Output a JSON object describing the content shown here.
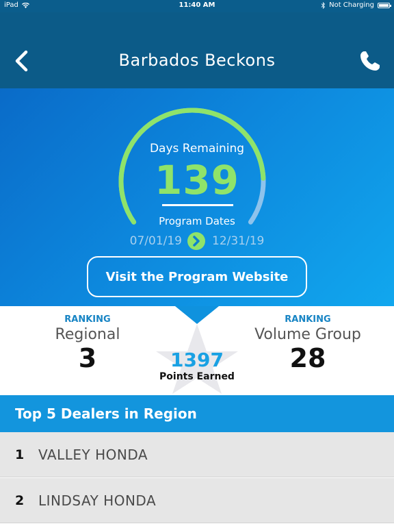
{
  "status_bar": {
    "device": "iPad",
    "time": "11:40 AM",
    "charging": "Not Charging"
  },
  "nav": {
    "title": "Barbados Beckons",
    "back_icon": "chevron-left-icon",
    "call_icon": "phone-icon"
  },
  "program": {
    "days_remaining_label": "Days Remaining",
    "days_remaining": "139",
    "days_remaining_progress": 0.85,
    "dates_label": "Program Dates",
    "start_date": "07/01/19",
    "end_date": "12/31/19",
    "visit_label": "Visit the Program Website"
  },
  "ranking": {
    "regional": {
      "caption": "RANKING",
      "name": "Regional",
      "value": "3"
    },
    "volume_group": {
      "caption": "RANKING",
      "name": "Volume Group",
      "value": "28"
    },
    "points_value": "1397",
    "points_label": "Points Earned"
  },
  "dealers": {
    "title": "Top 5 Dealers in Region",
    "rows": [
      {
        "rank": "1",
        "name": "VALLEY HONDA"
      },
      {
        "rank": "2",
        "name": "LINDSAY HONDA"
      }
    ]
  },
  "colors": {
    "nav": "#0c5b88",
    "accent_green": "#8fe36a",
    "accent_blue": "#1395dd"
  }
}
